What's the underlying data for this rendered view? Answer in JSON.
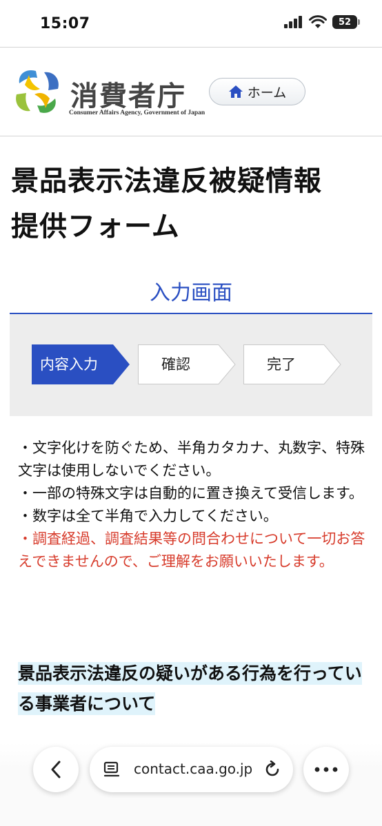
{
  "status": {
    "time": "15:07",
    "battery": "52"
  },
  "header": {
    "logo_text": "消費者庁",
    "logo_subtitle": "Consumer Affairs Agency, Government of Japan",
    "home_label": "ホーム"
  },
  "page": {
    "title_line1": "景品表示法違反被疑情報",
    "title_line2": "提供フォーム",
    "screen_label": "入力画面"
  },
  "steps": [
    {
      "label": "内容入力",
      "active": true
    },
    {
      "label": "確認",
      "active": false
    },
    {
      "label": "完了",
      "active": false
    }
  ],
  "notices": [
    "・文字化けを防ぐため、半角カタカナ、丸数字、特殊文字は使用しないでください。",
    "・一部の特殊文字は自動的に置き換えて受信します。",
    "・数字は全て半角で入力してください。"
  ],
  "warning_notice": "・調査経過、調査結果等の問合わせについて一切お答えできませんので、ご理解をお願いいたします。",
  "section_heading": "景品表示法違反の疑いがある行為を行っている事業者について",
  "browser": {
    "url": "contact.caa.go.jp"
  },
  "colors": {
    "accent": "#2a4fc2",
    "active_step": "#2a4fc2",
    "warning": "#d73b2b",
    "heading_highlight": "#dff3fb"
  }
}
